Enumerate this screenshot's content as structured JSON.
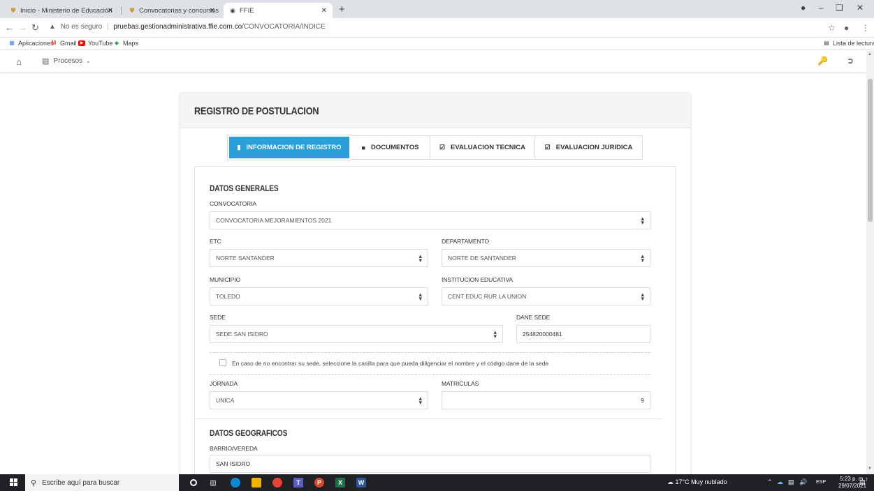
{
  "browser": {
    "tabs": [
      {
        "title": "Inicio - Ministerio de Educación",
        "active": false
      },
      {
        "title": "Convocatorias y concursos - Min",
        "active": false
      },
      {
        "title": "FFIE",
        "active": true
      }
    ],
    "url_warning": "No es seguro",
    "url_host": "pruebas.gestionadministrativa.ffie.com.co",
    "url_path": "/CONVOCATORIA/INDICE",
    "bookmarks": [
      "Aplicaciones",
      "Gmail",
      "YouTube",
      "Maps"
    ],
    "reading_list": "Lista de lectura"
  },
  "appnav": {
    "menu_label": "Procesos"
  },
  "form": {
    "title": "REGISTRO DE POSTULACION",
    "tabs": [
      {
        "label": "INFORMACION DE REGISTRO",
        "icon": "file-icon",
        "active": true
      },
      {
        "label": "DOCUMENTOS",
        "icon": "folder-icon",
        "active": false
      },
      {
        "label": "EVALUACION TECNICA",
        "icon": "check-square-icon",
        "active": false
      },
      {
        "label": "EVALUACION JURIDICA",
        "icon": "check-square-icon",
        "active": false
      }
    ],
    "datos_generales": {
      "title": "DATOS GENERALES",
      "convocatoria_label": "CONVOCATORIA",
      "convocatoria_value": "CONVOCATORIA MEJORAMIENTOS 2021",
      "etc_label": "ETC",
      "etc_value": "NORTE SANTANDER",
      "departamento_label": "DEPARTAMENTO",
      "departamento_value": "NORTE DE SANTANDER",
      "municipio_label": "MUNICIPIO",
      "municipio_value": "TOLEDO",
      "institucion_label": "INSTITUCION EDUCATIVA",
      "institucion_value": "CENT EDUC RUR LA UNION",
      "sede_label": "SEDE",
      "sede_value": "SEDE SAN ISIDRO",
      "dane_label": "DANE SEDE",
      "dane_value": "254820000481",
      "checkbox_text": "En caso de no encontrar su sede, seleccione la casilla para que pueda diligenciar el nombre y el código dane de la sede",
      "checkbox_checked": false,
      "jornada_label": "JORNADA",
      "jornada_value": "UNICA",
      "matriculas_label": "MATRICULAS",
      "matriculas_value": "9"
    },
    "datos_geograficos": {
      "title": "DATOS GEOGRAFICOS",
      "barrio_label": "BARRIO/VEREDA",
      "barrio_value": "SAN ISIDRO"
    }
  },
  "taskbar": {
    "search_placeholder": "Escribe aquí para buscar",
    "weather": "17°C  Muy nublado",
    "lang": "ESP",
    "time": "5:23 p. m.",
    "date": "29/07/2021",
    "notifications": "7"
  },
  "colors": {
    "accent": "#2a9fd8",
    "taskbar": "#202124"
  }
}
